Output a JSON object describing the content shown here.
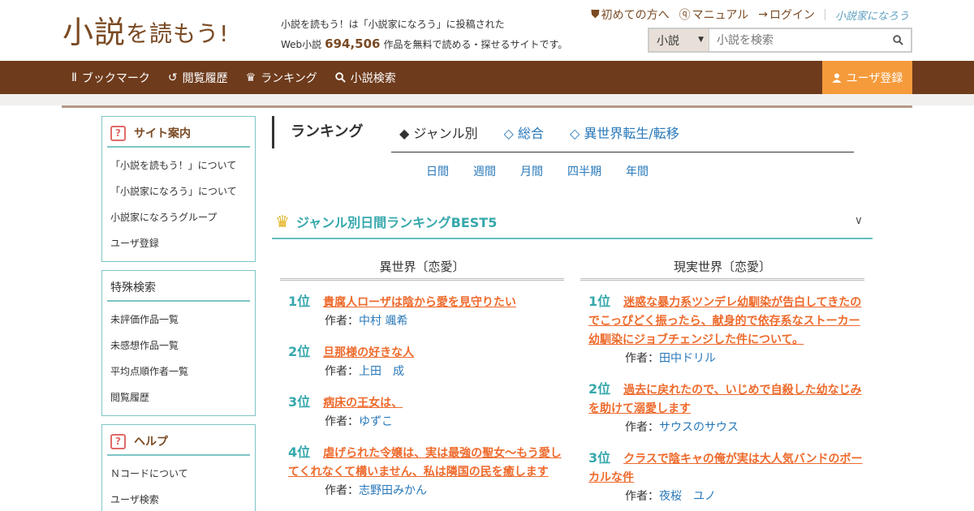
{
  "header": {
    "logo_main": "小説",
    "logo_rest": "を読もう!",
    "tagline_line1": "小説を読もう！は「小説家になろう」に投稿された",
    "tagline_prefix": "Web小説",
    "tagline_count": "694,506",
    "tagline_suffix": "作品を無料で読める・探せるサイトです。",
    "top_links": [
      {
        "label": "初めての方へ",
        "icon": "shield-icon"
      },
      {
        "label": "マニュアル",
        "icon": "help-circle-icon"
      },
      {
        "label": "ログイン",
        "icon": "login-icon"
      }
    ],
    "narou_logo": "小説家になろう",
    "search": {
      "select_value": "小説",
      "placeholder": "小説を検索"
    }
  },
  "nav": {
    "items": [
      {
        "label": "ブックマーク",
        "icon": "bookshelf-icon"
      },
      {
        "label": "閲覧履歴",
        "icon": "history-icon"
      },
      {
        "label": "ランキング",
        "icon": "crown-icon"
      },
      {
        "label": "小説検索",
        "icon": "search-icon"
      }
    ],
    "register": "ユーザ登録"
  },
  "sidebar": {
    "site_guide": {
      "title": "サイト案内",
      "items": [
        "「小説を読もう！」について",
        "「小説家になろう」について",
        "小説家になろうグループ",
        "ユーザ登録"
      ]
    },
    "special_search": {
      "title": "特殊検索",
      "items": [
        "未評価作品一覧",
        "未感想作品一覧",
        "平均点順作者一覧",
        "閲覧履歴"
      ]
    },
    "help": {
      "title": "ヘルプ",
      "items": [
        "Ｎコードについて",
        "ユーザ検索"
      ]
    }
  },
  "ranking": {
    "title": "ランキング",
    "tabs": [
      "◆ ジャンル別",
      "◇ 総合",
      "◇ 異世界転生/転移"
    ],
    "periods": [
      "日間",
      "週間",
      "月間",
      "四半期",
      "年間"
    ],
    "best_title": "ジャンル別日間ランキングBEST5",
    "author_label": "作者：",
    "left": {
      "genre": "異世界〔恋愛〕",
      "entries": [
        {
          "rank": "1位",
          "title": "貴腐人ローザは陰から愛を見守りたい",
          "author": "中村 颯希"
        },
        {
          "rank": "2位",
          "title": "旦那様の好きな人",
          "author": "上田　成"
        },
        {
          "rank": "3位",
          "title": "病床の王女は、",
          "author": "ゆずこ"
        },
        {
          "rank": "4位",
          "title": "虐げられた令嬢は、実は最強の聖女～もう愛してくれなくて構いません、私は隣国の民を癒します",
          "author": "志野田みかん"
        }
      ]
    },
    "right": {
      "genre": "現実世界〔恋愛〕",
      "entries": [
        {
          "rank": "1位",
          "title": "迷惑な暴力系ツンデレ幼馴染が告白してきたのでこっぴどく振ったら、献身的で依存系なストーカー幼馴染にジョブチェンジした件について。",
          "author": "田中ドリル"
        },
        {
          "rank": "2位",
          "title": "過去に戻れたので、いじめで自殺した幼なじみを助けて溺愛します",
          "author": "サウスのサウス"
        },
        {
          "rank": "3位",
          "title": "クラスで陰キャの俺が実は大人気バンドのボーカルな件",
          "author": "夜桜　ユノ"
        }
      ]
    }
  },
  "colors": {
    "brand_brown": "#6e3b1c",
    "accent_orange": "#f59b3c",
    "teal": "#36a8ad",
    "link_blue": "#2878b9",
    "title_orange": "#ee6a2c"
  }
}
